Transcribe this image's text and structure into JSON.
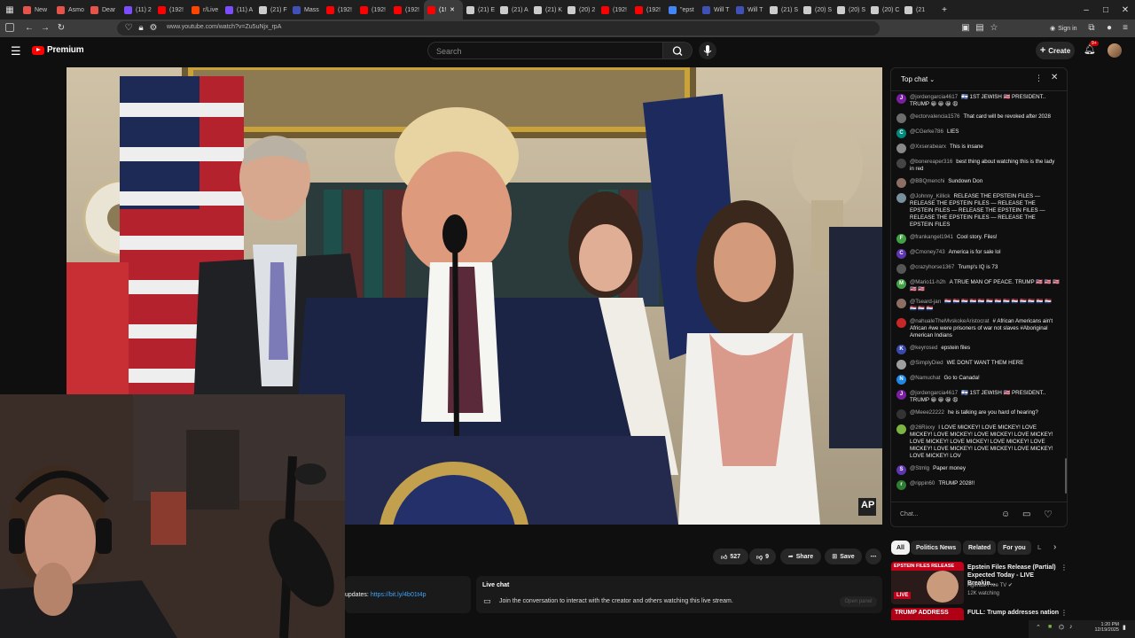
{
  "browser": {
    "tabs": [
      {
        "label": "",
        "color": "#555555"
      },
      {
        "label": "New",
        "color": "#e5534b"
      },
      {
        "label": "Asmo",
        "color": "#e5534b"
      },
      {
        "label": "Dear",
        "color": "#e5534b"
      },
      {
        "label": "(11) 2",
        "color": "#7c4dff"
      },
      {
        "label": "(192!",
        "color": "#ff0000"
      },
      {
        "label": "r/Live",
        "color": "#ff4500"
      },
      {
        "label": "(11) A",
        "color": "#7c4dff"
      },
      {
        "label": "(21) F",
        "color": "#cccccc"
      },
      {
        "label": "Mass",
        "color": "#3f51b5"
      },
      {
        "label": "(192!",
        "color": "#ff0000"
      },
      {
        "label": "(192!",
        "color": "#ff0000"
      },
      {
        "label": "(192!",
        "color": "#ff0000"
      },
      {
        "label": "(1!",
        "color": "#ff0000",
        "active": true
      },
      {
        "label": "(21) E",
        "color": "#cccccc"
      },
      {
        "label": "(21) A",
        "color": "#cccccc"
      },
      {
        "label": "(21) K",
        "color": "#cccccc"
      },
      {
        "label": "(20) 2",
        "color": "#cccccc"
      },
      {
        "label": "(192!",
        "color": "#ff0000"
      },
      {
        "label": "(192!",
        "color": "#ff0000"
      },
      {
        "label": "\"epst",
        "color": "#4285f4"
      },
      {
        "label": "Will T",
        "color": "#3f51b5"
      },
      {
        "label": "Will T",
        "color": "#3f51b5"
      },
      {
        "label": "(21) S",
        "color": "#cccccc"
      },
      {
        "label": "(20) S",
        "color": "#cccccc"
      },
      {
        "label": "(20) S",
        "color": "#cccccc"
      },
      {
        "label": "(20) C",
        "color": "#cccccc"
      },
      {
        "label": "(21",
        "color": "#cccccc"
      }
    ],
    "url": "www.youtube.com/watch?v=Zu5uNjx_rpA",
    "signin_label": "Sign in"
  },
  "youtube": {
    "logo_text": "Premium",
    "search_placeholder": "Search",
    "create_label": "Create",
    "notif_badge": "9+"
  },
  "chat": {
    "mode_label": "Top chat",
    "input_placeholder": "Chat...",
    "messages": [
      {
        "author": "@jordengarcia4617",
        "text": "🇮🇱 1ST JEWISH 🇺🇸 PRESIDENT.. TRUMP 😀 😀 😀 😩",
        "avatar": "J",
        "color": "#7b1fa2"
      },
      {
        "author": "@ectorvalencia1576",
        "text": "That card will be revoked after 2028",
        "avatar": "",
        "color": "#6d6d6d"
      },
      {
        "author": "@CGerke786",
        "text": "LIES",
        "avatar": "C",
        "color": "#00897b"
      },
      {
        "author": "@Xxserabearx",
        "text": "This is insane",
        "avatar": "",
        "color": "#888888"
      },
      {
        "author": "@bonereaper316",
        "text": "best thing about watching this is the lady in red",
        "avatar": "",
        "color": "#444444"
      },
      {
        "author": "@BBQmenchi",
        "text": "Sundown Don",
        "avatar": "",
        "color": "#8d6e63"
      },
      {
        "author": "@Johnny_Killick",
        "text": "RELEASE THE EPSTEIN FILES — RELEASE THE EPSTEIN FILES — RELEASE THE EPSTEIN FILES — RELEASE THE EPSTEIN FILES — RELEASE THE EPSTEIN FILES — RELEASE THE EPSTEIN FILES",
        "avatar": "",
        "color": "#78909c"
      },
      {
        "author": "@frankangel1941",
        "text": "Cool story. Files!",
        "avatar": "F",
        "color": "#43a047"
      },
      {
        "author": "@Cmoney743",
        "text": "America is for sale lol",
        "avatar": "C",
        "color": "#5e35b1"
      },
      {
        "author": "@crazyhorse1367",
        "text": "Trump's IQ is 73",
        "avatar": "",
        "color": "#555555"
      },
      {
        "author": "@Mario11-h2h",
        "text": "A TRUE MAN OF PEACE. TRUMP 🇺🇸 🇺🇸 🇺🇸 🇺🇸 🇺🇸",
        "avatar": "M",
        "color": "#43a047"
      },
      {
        "author": "@Tseard-jan",
        "text": "🇳🇱 🇳🇱 🇳🇱 🇳🇱 🇳🇱 🇳🇱 🇳🇱 🇳🇱 🇳🇱 🇳🇱 🇳🇱 🇳🇱 🇳🇱 🇳🇱 🇳🇱 🇳🇱",
        "avatar": "",
        "color": "#8d6e63"
      },
      {
        "author": "@nahualeTheMvskokeAristocrat",
        "text": "# African Americans ain't African #we were prisoners of war not slaves #Aboriginal American Indians",
        "avatar": "",
        "color": "#c62828"
      },
      {
        "author": "@keyrosed",
        "text": "epstein files",
        "avatar": "K",
        "color": "#3949ab"
      },
      {
        "author": "@SimplyDied",
        "text": "WE DONT WANT THEM HERE",
        "avatar": "",
        "color": "#9e9e9e"
      },
      {
        "author": "@Namuchat",
        "text": "Go to Canada!",
        "avatar": "N",
        "color": "#1e88e5"
      },
      {
        "author": "@jordengarcia4617",
        "text": "🇮🇱 1ST JEWISH 🇺🇸 PRESIDENT.. TRUMP 😀 😀 😀 😩",
        "avatar": "J",
        "color": "#7b1fa2"
      },
      {
        "author": "@Meee22222",
        "text": "he is talking are you hard of hearing?",
        "avatar": "",
        "color": "#333333"
      },
      {
        "author": "@26Rixxy",
        "text": "I LOVE MICKEY! LOVE MICKEY! LOVE MICKEY! LOVE MICKEY! LOVE MICKEY! LOVE MICKEY! LOVE MICKEY! LOVE MICKEY! LOVE MICKEY! LOVE MICKEY! LOVE MICKEY! LOVE MICKEY! LOVE MICKEY! LOVE MICKEY! LOV",
        "avatar": "",
        "color": "#7cb342"
      },
      {
        "author": "@Stmlg",
        "text": "Paper money",
        "avatar": "S",
        "color": "#5e35b1"
      },
      {
        "author": "@rippin60",
        "text": "TRUMP 2028!!",
        "avatar": "r",
        "color": "#2e7d32"
      }
    ]
  },
  "video": {
    "ap_badge": "AP",
    "like_count": "527",
    "dislike_count": "9",
    "share_label": "Share",
    "save_label": "Save",
    "updates_label": "updates:",
    "updates_link": "https://bit.ly/4b01t4p",
    "livechat_title": "Live chat",
    "livechat_text": "Join the conversation to interact with the creator and others watching this live stream.",
    "open_panel_label": "Open panel"
  },
  "recommendations": {
    "chips": [
      "All",
      "Politics News",
      "Related",
      "For you",
      "L"
    ],
    "items": [
      {
        "thumb_text": "EPSTEIN FILES RELEASE",
        "title": "Epstein Files Release (Partial) Expected Today - LIVE Breakin...",
        "channel": "Agenda-Free TV",
        "meta": "12K watching",
        "live": "LIVE"
      },
      {
        "thumb_text": "TRUMP ADDRESS",
        "title": "FULL: Trump addresses nation",
        "channel": "",
        "meta": "",
        "live": ""
      }
    ]
  },
  "taskbar": {
    "time": "1:20 PM",
    "date": "12/19/2025"
  }
}
